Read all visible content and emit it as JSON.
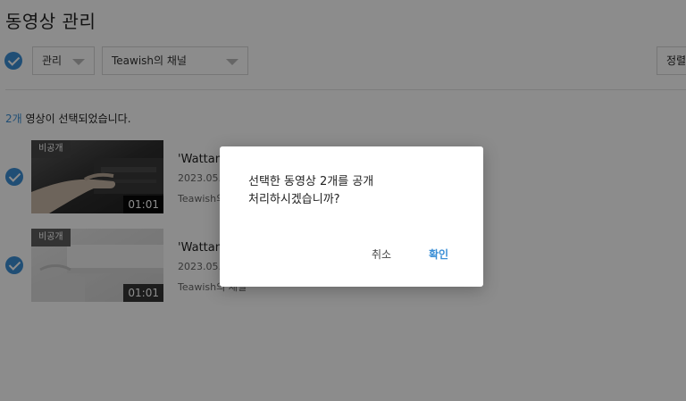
{
  "page": {
    "title": "동영상 관리"
  },
  "toolbar": {
    "manage_label": "관리",
    "channel_label": "Teawish의 채널",
    "sort_label": "정렬"
  },
  "selection": {
    "count": "2개",
    "suffix": " 영상이 선택되었습니다."
  },
  "videos": [
    {
      "badge": "비공개",
      "duration": "01:01",
      "title": "'Wattam",
      "date": "2023.05.2",
      "channel": "Teawish의"
    },
    {
      "badge": "비공개",
      "duration": "01:01",
      "title": "'Wattam",
      "date": "2023.05.2",
      "channel": "Teawish의 채널"
    }
  ],
  "dialog": {
    "message": "선택한 동영상 2개를 공개 처리하시겠습니까?",
    "cancel_label": "취소",
    "confirm_label": "확인"
  },
  "colors": {
    "accent": "#3b8fd6",
    "overlay": "rgba(0,0,0,0.45)"
  }
}
